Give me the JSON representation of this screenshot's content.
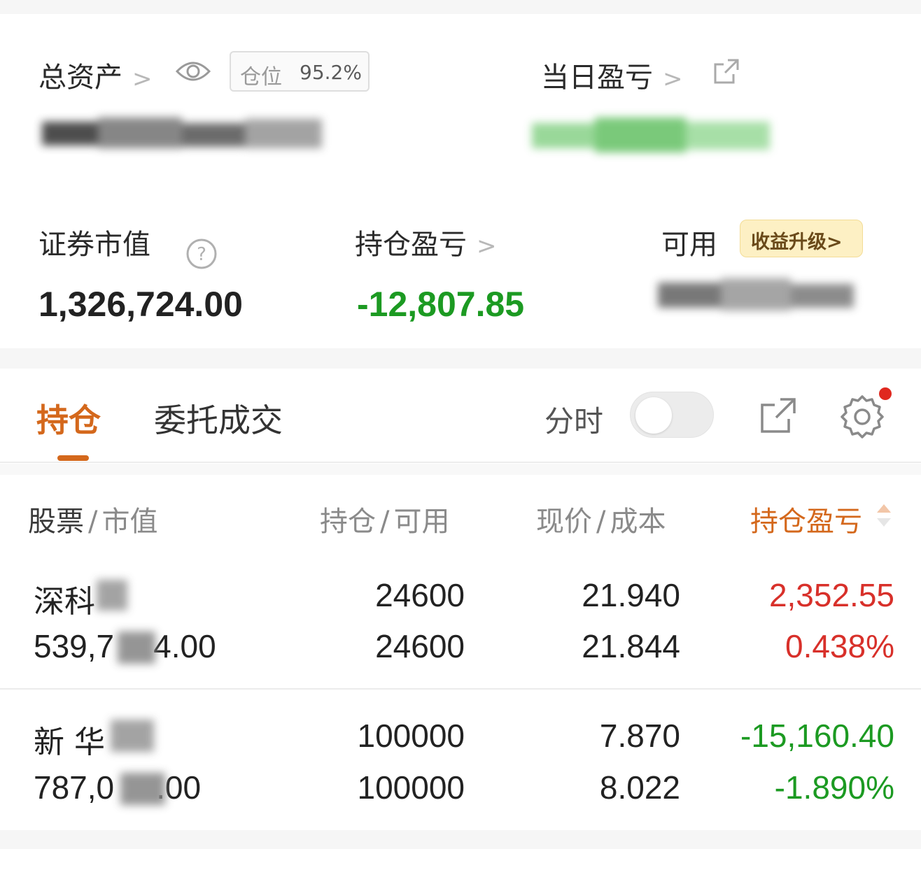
{
  "summary": {
    "total_assets_label": "总资产",
    "position_label": "仓位",
    "position_value": "95.2%",
    "daily_pnl_label": "当日盈亏",
    "market_value_label": "证券市值",
    "market_value": "1,326,724.00",
    "holding_pnl_label": "持仓盈亏",
    "holding_pnl": "-12,807.85",
    "available_label": "可用",
    "promo_label": "收益升级>",
    "chevron": ">"
  },
  "tabs": {
    "holdings": "持仓",
    "orders": "委托成交",
    "time_share_label": "分时",
    "time_share_on": false
  },
  "table": {
    "headers": [
      {
        "main": "股票",
        "sub": "市值"
      },
      {
        "main": "持仓",
        "sub": "可用"
      },
      {
        "main": "现价",
        "sub": "成本"
      },
      {
        "main": "持仓盈亏",
        "sub": ""
      }
    ],
    "separator": "/",
    "rows": [
      {
        "name": "深科",
        "market_value": "539,7",
        "market_value_tail": "4.00",
        "quantity": "24600",
        "available": "24600",
        "price": "21.940",
        "cost": "21.844",
        "pnl": "2,352.55",
        "pnl_pct": "0.438%",
        "trend": "up"
      },
      {
        "name": "新 华",
        "market_value": "787,0",
        "market_value_tail": ".00",
        "quantity": "100000",
        "available": "100000",
        "price": "7.870",
        "cost": "8.022",
        "pnl": "-15,160.40",
        "pnl_pct": "-1.890%",
        "trend": "down"
      }
    ]
  },
  "colors": {
    "accent": "#d4681c",
    "up": "#d8302a",
    "down": "#1c9a22",
    "promo_bg": "#fdf0c4"
  },
  "icons": [
    "eye-icon",
    "share-icon",
    "help-icon",
    "export-icon",
    "gear-icon",
    "sort-icon"
  ]
}
